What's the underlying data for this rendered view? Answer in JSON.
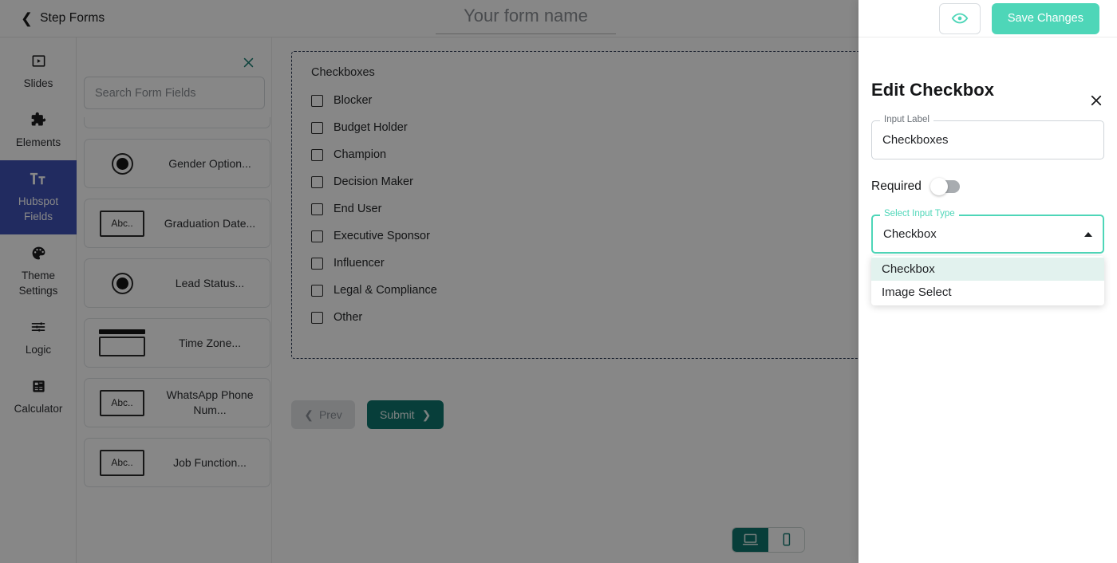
{
  "topbar": {
    "back_label": "Step Forms",
    "back_icon": "chevron-left-icon",
    "form_name_value": "",
    "form_name_placeholder": "Your form name",
    "preview_icon": "eye-icon",
    "save_label": "Save Changes"
  },
  "rail": {
    "items": [
      {
        "label": "Slides",
        "icon": "slide-icon",
        "active": false
      },
      {
        "label": "Elements",
        "icon": "puzzle-piece-icon",
        "active": false
      },
      {
        "label": "Hubspot Fields",
        "icon": "text-format-icon",
        "active": true
      },
      {
        "label": "Theme Settings",
        "icon": "palette-icon",
        "active": false
      },
      {
        "label": "Logic",
        "icon": "sliders-icon",
        "active": false
      },
      {
        "label": "Calculator",
        "icon": "calculator-icon",
        "active": false
      }
    ],
    "active_color": "#3F51B5"
  },
  "fields_panel": {
    "close_icon": "close-icon",
    "close_color": "#1b7f73",
    "search_value": "",
    "search_placeholder": "Search Form Fields",
    "cards": [
      {
        "name": "",
        "icon": "select-icon",
        "clipped": true
      },
      {
        "name": "Gender Option...",
        "icon": "radio-icon",
        "clipped": false
      },
      {
        "name": "Graduation Date...",
        "icon": "abc-icon",
        "icon_text": "Abc..",
        "clipped": false
      },
      {
        "name": "Lead Status...",
        "icon": "radio-icon",
        "clipped": false
      },
      {
        "name": "Time Zone...",
        "icon": "select-icon",
        "clipped": false
      },
      {
        "name": "WhatsApp Phone Num...",
        "icon": "abc-icon",
        "icon_text": "Abc..",
        "clipped": false
      },
      {
        "name": "Job Function...",
        "icon": "abc-icon",
        "icon_text": "Abc..",
        "clipped": false
      }
    ]
  },
  "canvas": {
    "group_label": "Checkboxes",
    "checkboxes": [
      "Blocker",
      "Budget Holder",
      "Champion",
      "Decision Maker",
      "End User",
      "Executive Sponsor",
      "Influencer",
      "Legal & Compliance",
      "Other"
    ],
    "prev_label": "Prev",
    "prev_icon": "chevron-left-icon",
    "submit_label": "Submit",
    "submit_icon": "chevron-right-icon",
    "submit_color": "#0f766e"
  },
  "footer": {
    "devices": [
      {
        "icon": "desktop-icon",
        "name": "desktop",
        "active": true
      },
      {
        "icon": "mobile-icon",
        "name": "mobile",
        "active": false
      }
    ]
  },
  "drawer": {
    "close_icon": "close-icon",
    "title": "Edit Checkbox",
    "input_label_legend": "Input Label",
    "input_label_value": "Checkboxes",
    "required_label": "Required",
    "required_on": false,
    "select_legend": "Select Input Type",
    "select_value": "Checkbox",
    "select_caret_icon": "caret-up-icon",
    "accent_color": "#4ED6B8",
    "options": [
      {
        "label": "Checkbox",
        "selected": true
      },
      {
        "label": "Image Select",
        "selected": false
      }
    ]
  }
}
